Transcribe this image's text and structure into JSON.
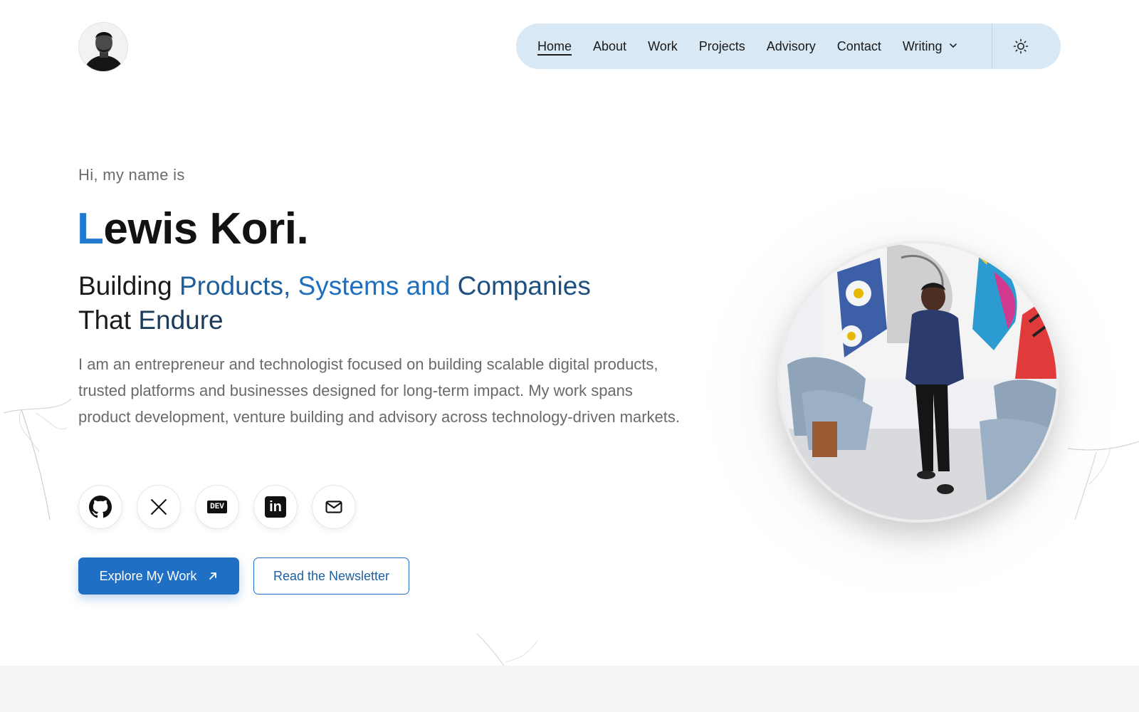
{
  "nav": {
    "items": [
      {
        "label": "Home",
        "active": true
      },
      {
        "label": "About"
      },
      {
        "label": "Work"
      },
      {
        "label": "Projects"
      },
      {
        "label": "Advisory"
      },
      {
        "label": "Contact"
      },
      {
        "label": "Writing",
        "dropdown": true
      }
    ],
    "dropdown_icon": "chevron-down-icon",
    "theme_icon": "sun-icon"
  },
  "hero": {
    "greeting": "Hi, my name is",
    "name_first_letter": "L",
    "name_rest": "ewis Kori.",
    "tagline": {
      "w1": "Building ",
      "w2": "Products,",
      "w3": " Systems and",
      "w4": " Companies",
      "w5": "That",
      "w6": " Endure"
    },
    "intro": "I am an entrepreneur and technologist focused on building scalable digital products, trusted platforms and businesses designed for long-term impact. My work spans product development, venture building and advisory across technology-driven markets."
  },
  "socials": [
    {
      "icon": "github-icon"
    },
    {
      "icon": "x-icon"
    },
    {
      "icon": "dev-icon",
      "text": "DEV"
    },
    {
      "icon": "linkedin-icon",
      "text": "in"
    },
    {
      "icon": "mail-icon"
    }
  ],
  "buttons": {
    "primary": "Explore My Work",
    "secondary": "Read the Newsletter"
  },
  "colors": {
    "accent": "#1f7ad0",
    "nav_bg": "#d8e8f5",
    "primary_button": "#1f6fc4"
  }
}
